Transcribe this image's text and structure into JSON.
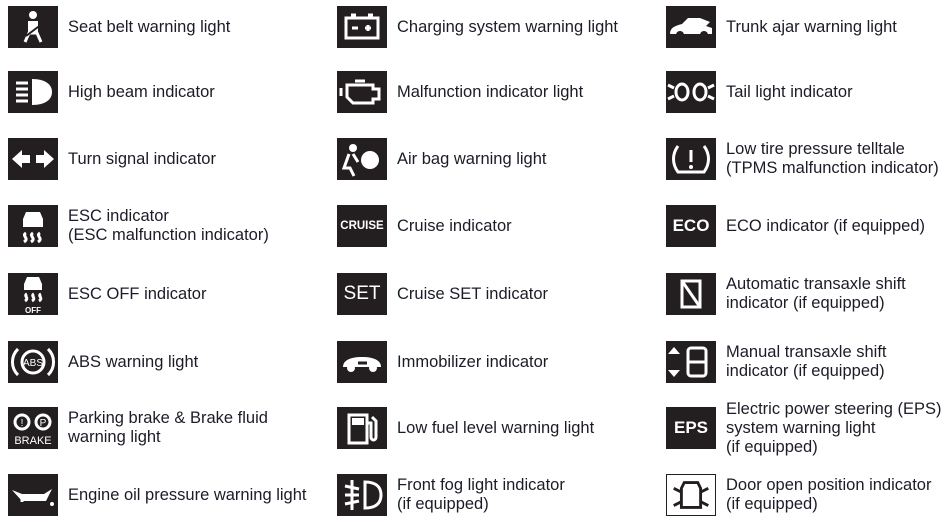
{
  "colors": {
    "icon_background": "#231f20",
    "icon_foreground": "#ffffff",
    "text": "#1c1c28"
  },
  "columns": [
    {
      "items": [
        {
          "icon": "seat-belt-icon",
          "label": "Seat belt warning light"
        },
        {
          "icon": "high-beam-icon",
          "label": "High beam indicator"
        },
        {
          "icon": "turn-signal-icon",
          "label": "Turn signal indicator"
        },
        {
          "icon": "esc-icon",
          "label": "ESC indicator\n(ESC malfunction indicator)"
        },
        {
          "icon": "esc-off-icon",
          "label": "ESC OFF indicator",
          "icon_text": "OFF"
        },
        {
          "icon": "abs-icon",
          "label": "ABS warning light",
          "icon_text": "ABS"
        },
        {
          "icon": "brake-icon",
          "label": "Parking brake & Brake fluid\nwarning light",
          "icon_text": "BRAKE"
        },
        {
          "icon": "oil-can-icon",
          "label": "Engine oil pressure warning light"
        }
      ]
    },
    {
      "items": [
        {
          "icon": "battery-icon",
          "label": "Charging system warning light"
        },
        {
          "icon": "engine-icon",
          "label": "Malfunction indicator light"
        },
        {
          "icon": "airbag-icon",
          "label": "Air bag warning light"
        },
        {
          "icon": "cruise-icon",
          "label": "Cruise indicator",
          "icon_text": "CRUISE"
        },
        {
          "icon": "set-icon",
          "label": "Cruise SET indicator",
          "icon_text": "SET"
        },
        {
          "icon": "immobilizer-icon",
          "label": "Immobilizer indicator"
        },
        {
          "icon": "fuel-pump-icon",
          "label": "Low fuel level warning light"
        },
        {
          "icon": "front-fog-icon",
          "label": "Front fog light indicator\n(if equipped)"
        }
      ]
    },
    {
      "items": [
        {
          "icon": "trunk-ajar-icon",
          "label": "Trunk ajar warning light"
        },
        {
          "icon": "tail-light-icon",
          "label": "Tail light indicator"
        },
        {
          "icon": "tpms-icon",
          "label": "Low tire pressure telltale\n(TPMS malfunction indicator)"
        },
        {
          "icon": "eco-icon",
          "label": "ECO indicator (if equipped)",
          "icon_text": "ECO"
        },
        {
          "icon": "auto-shift-icon",
          "label": "Automatic transaxle shift\nindicator (if equipped)"
        },
        {
          "icon": "manual-shift-icon",
          "label": "Manual transaxle shift\nindicator (if equipped)"
        },
        {
          "icon": "eps-icon",
          "label": "Electric power steering (EPS)\nsystem warning light\n(if equipped)",
          "icon_text": "EPS"
        },
        {
          "icon": "door-open-icon",
          "label": "Door open position indicator\n (if equipped)"
        }
      ]
    }
  ]
}
